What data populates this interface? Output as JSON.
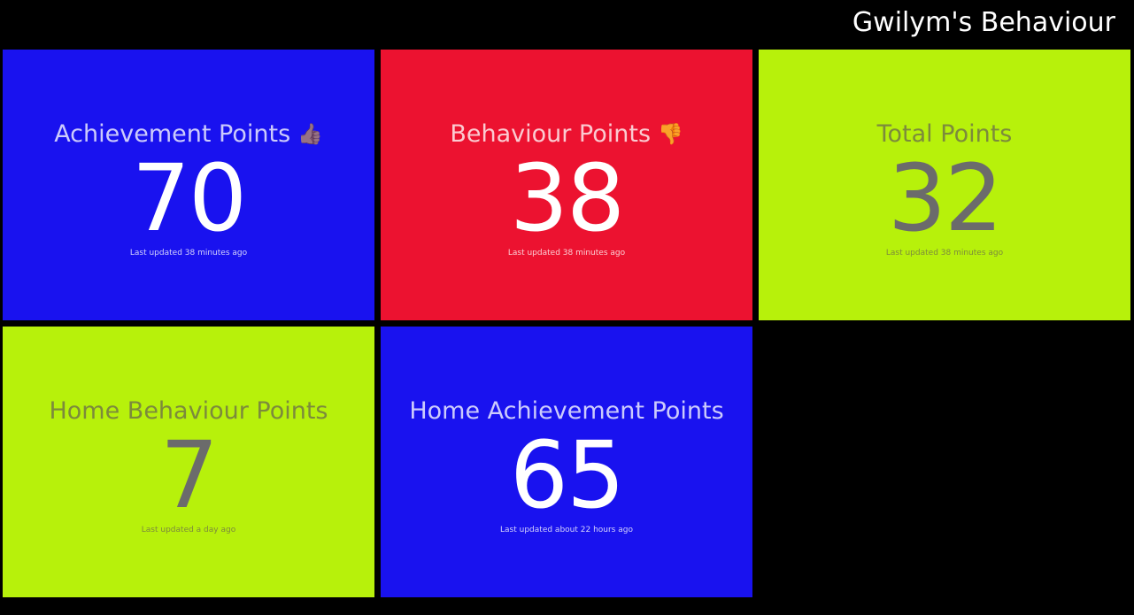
{
  "dashboard": {
    "title": "Gwilym's Behaviour"
  },
  "widgets": [
    {
      "title": "Achievement Points",
      "emoji": "👍🏽",
      "icon": "thumbs-up-icon",
      "value": "70",
      "updated": "Last updated 38 minutes ago",
      "color": "#1912ef"
    },
    {
      "title": "Behaviour Points",
      "emoji": "👎",
      "icon": "thumbs-down-icon",
      "value": "38",
      "updated": "Last updated 38 minutes ago",
      "color": "#ec1230"
    },
    {
      "title": "Total Points",
      "value": "32",
      "updated": "Last updated 38 minutes ago",
      "color": "#b7f10b"
    },
    {
      "title": "Home Behaviour Points",
      "value": "7",
      "updated": "Last updated a day ago",
      "color": "#b7f10b"
    },
    {
      "title": "Home Achievement Points",
      "value": "65",
      "updated": "Last updated about 22 hours ago",
      "color": "#1912ef"
    }
  ]
}
